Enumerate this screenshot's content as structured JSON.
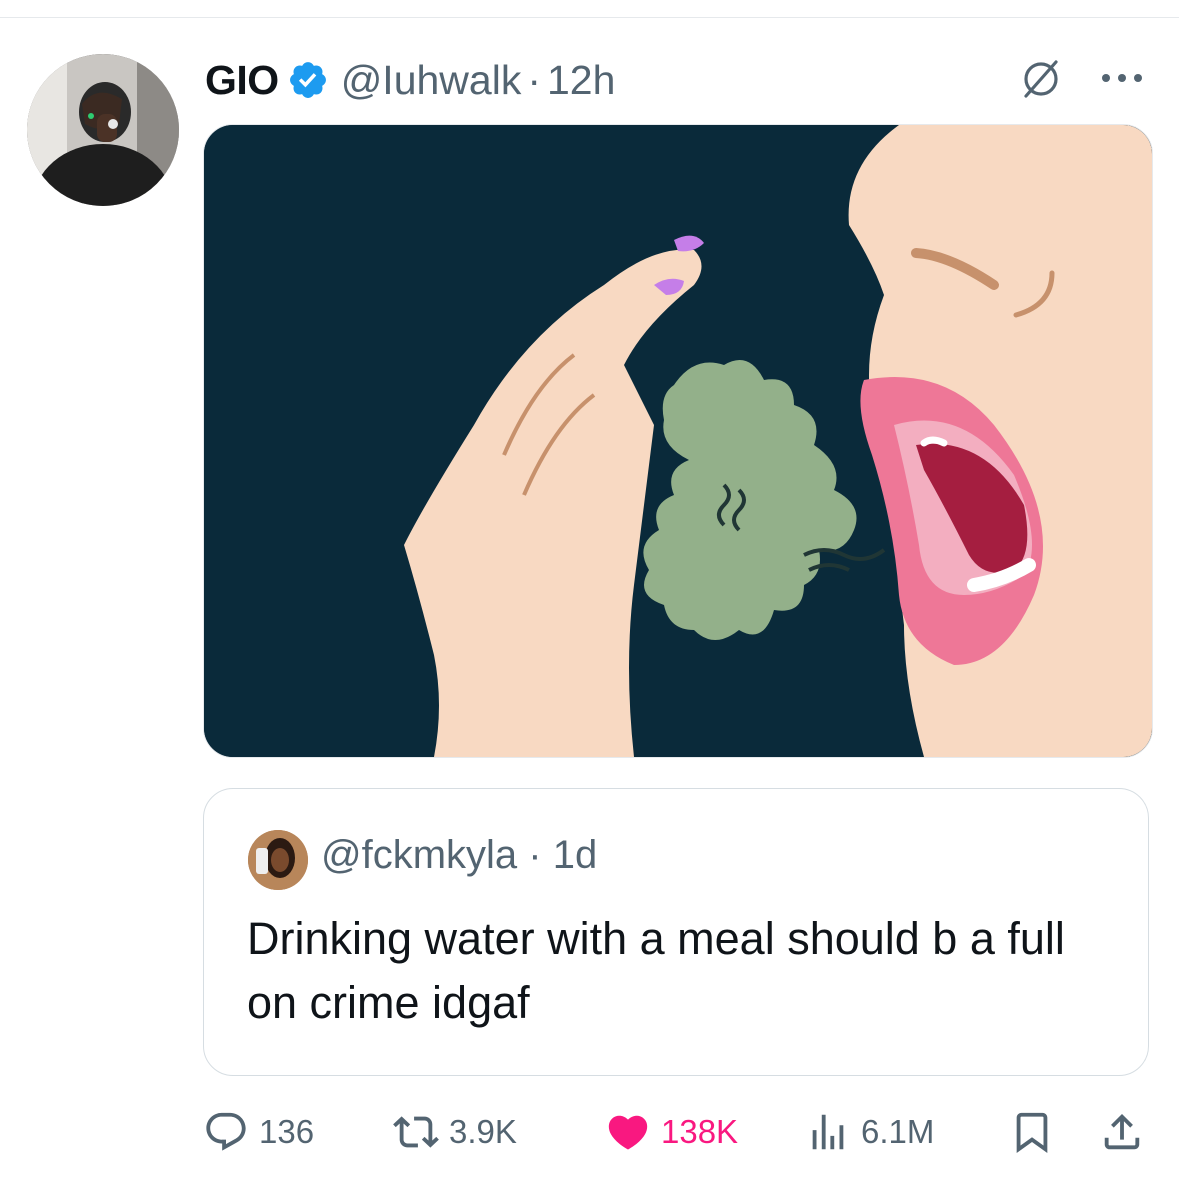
{
  "tweet": {
    "author": {
      "display_name": "GIO",
      "handle": "@Iuhwalk",
      "verified": true,
      "avatar_icon": "user-avatar"
    },
    "separator": "·",
    "time": "12h",
    "media": {
      "icon": "bad-breath-illustration"
    },
    "quoted": {
      "handle": "@fckmkyla",
      "separator": "·",
      "time": "1d",
      "text": "Drinking water with a meal should b a full on crime idgaf",
      "avatar_icon": "user-avatar"
    },
    "actions": {
      "replies": "136",
      "reposts": "3.9K",
      "likes": "138K",
      "views": "6.1M",
      "liked": true
    }
  },
  "colors": {
    "verified": "#1d9bf0",
    "like": "#f91880",
    "secondary_text": "#536471",
    "image_background": "#0a2a3a"
  },
  "icons": [
    "verified-badge-icon",
    "grok-icon",
    "more-icon",
    "reply-icon",
    "repost-icon",
    "like-icon",
    "views-icon",
    "bookmark-icon",
    "share-icon"
  ]
}
